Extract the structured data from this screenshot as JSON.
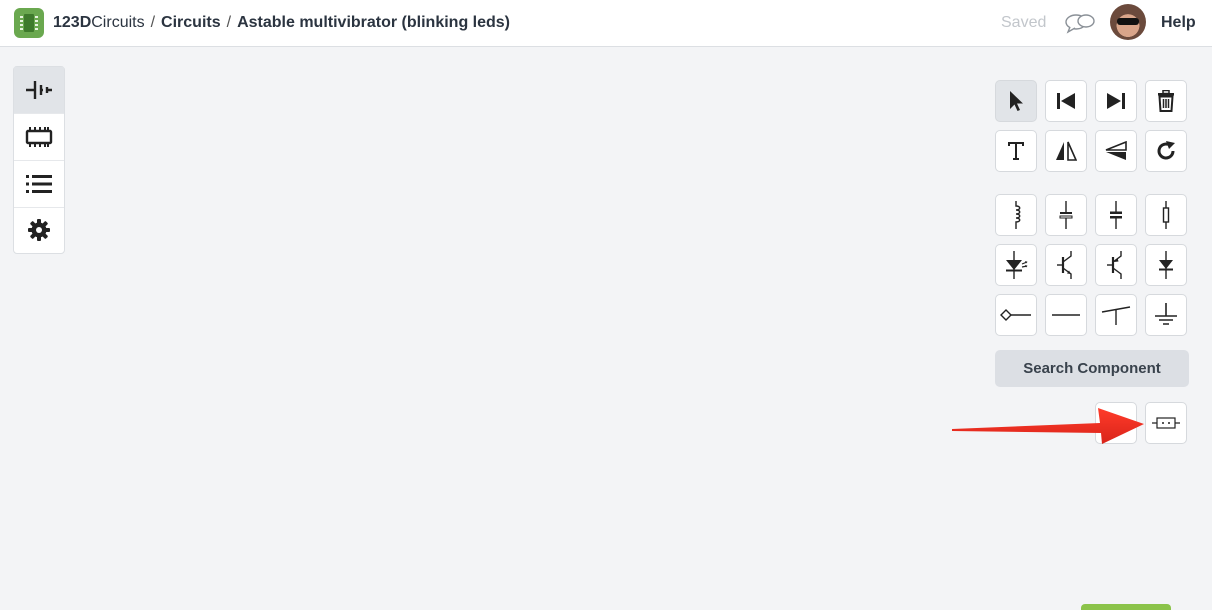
{
  "header": {
    "app_name_bold": "123D",
    "app_name_rest": "Circuits",
    "breadcrumb_section": "Circuits",
    "breadcrumb_separator": "/",
    "project_title": "Astable multivibrator (blinking leds)",
    "saved_status": "Saved",
    "help_label": "Help"
  },
  "sidebar": {
    "items": [
      {
        "name": "components-icon",
        "active": true
      },
      {
        "name": "breadboard-icon",
        "active": false
      },
      {
        "name": "list-icon",
        "active": false
      },
      {
        "name": "settings-icon",
        "active": false
      }
    ]
  },
  "toolbar": {
    "tools": [
      "select",
      "step-back",
      "step-forward",
      "delete",
      "text",
      "flip-horizontal",
      "flip-vertical",
      "rotate"
    ],
    "components": [
      "inductor",
      "capacitor-polarized",
      "capacitor",
      "resistor",
      "led",
      "npn-transistor",
      "pnp-transistor",
      "diode",
      "probe",
      "wire",
      "switch",
      "ground"
    ],
    "search_label": "Search Component",
    "recent_component": "integrated-circuit"
  },
  "annotation": {
    "arrow_color": "#ee2b1f"
  },
  "colors": {
    "brand_green": "#6aa84f",
    "background": "#f3f4f6"
  }
}
